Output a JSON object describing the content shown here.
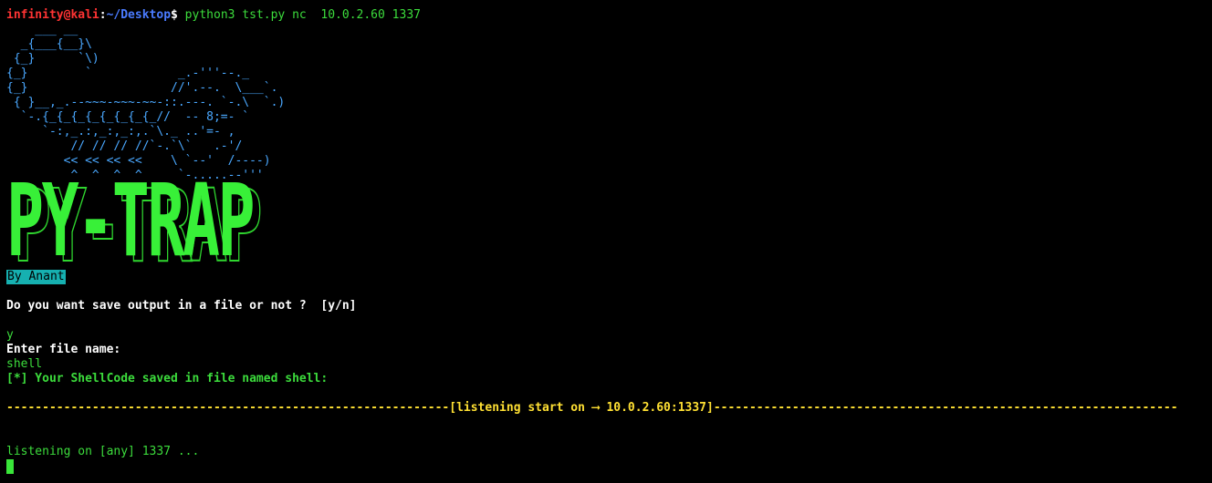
{
  "prompt": {
    "user_host": "infinity@kali",
    "separator": ":",
    "path": "~/Desktop",
    "symbol": "$",
    "command": " python3 tst.py nc  10.0.2.60 1337"
  },
  "ascii_art": "    ___ __\n  _{___{__}\\\n {_}      `\\)\n{_}        `            _.-'''--._\n{_}                    //'.--.  \\___`.\n { }__,_.--~~~-~~~-~~-::.---. `-.\\  `.)\n  `-.{_{_{_{_{_{_{_{_//  -- 8;=- `\n     `-:,_.:,_:,_:,.`\\._ ..'=- ,\n         // // // //`-.`\\`   .-'/\n        << << << <<    \\ `--'  /----)\n         ^  ^  ^  ^     `-.....--'''",
  "banner": "PY-TRAP",
  "byline": "By Anant",
  "question": "Do you want save output in a file or not ?  [y/n]",
  "answer": "y",
  "file_prompt": "Enter file name:",
  "file_name": "shell",
  "saved_msg": "[*] Your ShellCode saved in file named shell:",
  "listener_banner": "--------------------------------------------------------------[listening start on ⟶ 10.0.2.60:1337]-----------------------------------------------------------------",
  "listening": "listening on [any] 1337 ...",
  "colors": {
    "background": "#000000",
    "prompt_user": "#ff3333",
    "prompt_path": "#4a7bff",
    "green": "#3cdc3c",
    "art_blue": "#4aa8ff",
    "byline_bg": "#16b0b0",
    "yellow": "#ffe033"
  }
}
